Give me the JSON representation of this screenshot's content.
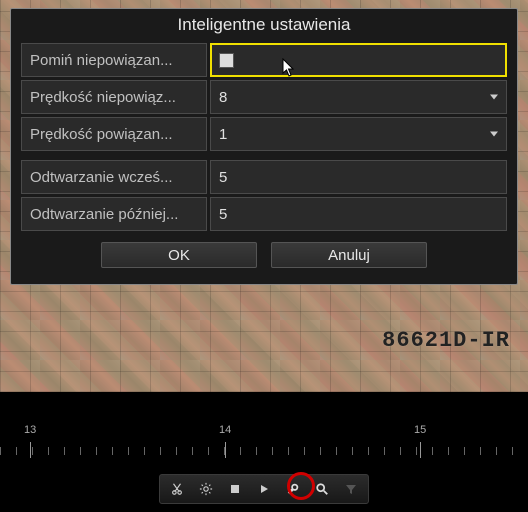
{
  "dialog": {
    "title": "Inteligentne ustawienia",
    "rows": {
      "skip_unrelated": {
        "label": "Pomiń niepowiązan...",
        "checked": false
      },
      "speed_unrelated": {
        "label": "Prędkość niepowiąz...",
        "value": "8"
      },
      "speed_related": {
        "label": "Prędkość powiązan...",
        "value": "1"
      },
      "play_before": {
        "label": "Odtwarzanie wcześ...",
        "value": "5"
      },
      "play_after": {
        "label": "Odtwarzanie później...",
        "value": "5"
      }
    },
    "buttons": {
      "ok": "OK",
      "cancel": "Anuluj"
    }
  },
  "camera_label": "86621D-IR",
  "timeline": {
    "hours": [
      "13",
      "14",
      "15"
    ]
  },
  "toolbar": {
    "icons": [
      "cut-icon",
      "settings-icon",
      "stop-icon",
      "play-icon",
      "wrench-icon",
      "search-icon",
      "filter-icon"
    ]
  }
}
